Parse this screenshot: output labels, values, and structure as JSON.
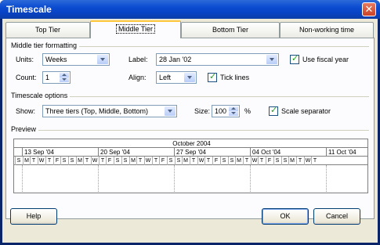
{
  "window": {
    "title": "Timescale",
    "close_glyph": "✕"
  },
  "tabs": [
    {
      "label": "Top Tier",
      "active": false
    },
    {
      "label": "Middle Tier",
      "active": true
    },
    {
      "label": "Bottom Tier",
      "active": false
    },
    {
      "label": "Non-working time",
      "active": false
    }
  ],
  "middle_tier": {
    "group_label": "Middle tier formatting",
    "units_label": "Units:",
    "units_value": "Weeks",
    "label_label": "Label:",
    "label_value": "28 Jan '02",
    "fiscal_year_label": "Use fiscal year",
    "fiscal_year_checked": true,
    "count_label": "Count:",
    "count_value": "1",
    "align_label": "Align:",
    "align_value": "Left",
    "tick_lines_label": "Tick lines",
    "tick_lines_checked": true
  },
  "timescale_options": {
    "group_label": "Timescale options",
    "show_label": "Show:",
    "show_value": "Three tiers (Top, Middle, Bottom)",
    "size_label": "Size:",
    "size_value": "100",
    "size_unit": "%",
    "scale_separator_label": "Scale separator",
    "scale_separator_checked": true
  },
  "preview": {
    "group_label": "Preview",
    "top_tier": "October 2004",
    "middle_tier": [
      "13 Sep '04",
      "20 Sep '04",
      "27 Sep '04",
      "04 Oct '04",
      "11 Oct '04"
    ],
    "bottom_tier": [
      "S",
      "M",
      "T",
      "W",
      "T",
      "F",
      "S",
      "S",
      "M",
      "T",
      "W",
      "T",
      "F",
      "S",
      "S",
      "M",
      "T",
      "W",
      "T",
      "F",
      "S",
      "S",
      "M",
      "T",
      "W",
      "T",
      "F",
      "S",
      "S",
      "M",
      "T",
      "W",
      "T",
      "F",
      "S",
      "S",
      "M",
      "T",
      "W",
      "T"
    ]
  },
  "buttons": {
    "help": "Help",
    "ok": "OK",
    "cancel": "Cancel"
  },
  "colors": {
    "titlebar": "#0a4bd0",
    "dialog_bg": "#ece9d8",
    "tab_highlight": "#ffc83c"
  }
}
